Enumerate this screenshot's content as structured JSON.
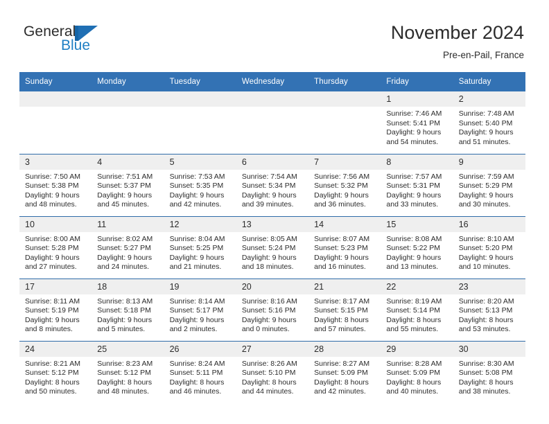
{
  "brand": {
    "name_part1": "General",
    "name_part2": "Blue"
  },
  "header": {
    "title": "November 2024",
    "subtitle": "Pre-en-Pail, France"
  },
  "calendar": {
    "weekday_headers": [
      "Sunday",
      "Monday",
      "Tuesday",
      "Wednesday",
      "Thursday",
      "Friday",
      "Saturday"
    ],
    "labels": {
      "sunrise": "Sunrise:",
      "sunset": "Sunset:",
      "daylight": "Daylight:"
    },
    "colors": {
      "header_blue": "#3372b4",
      "daynum_band": "#efefef",
      "row_separator": "#2e6ba8",
      "brand_blue": "#1f7fc4",
      "text": "#2b2b2b"
    },
    "weeks": [
      [
        {
          "day": "",
          "empty": true
        },
        {
          "day": "",
          "empty": true
        },
        {
          "day": "",
          "empty": true
        },
        {
          "day": "",
          "empty": true
        },
        {
          "day": "",
          "empty": true
        },
        {
          "day": "1",
          "sunrise": "Sunrise: 7:46 AM",
          "sunset": "Sunset: 5:41 PM",
          "daylight_line1": "Daylight: 9 hours",
          "daylight_line2": "and 54 minutes."
        },
        {
          "day": "2",
          "sunrise": "Sunrise: 7:48 AM",
          "sunset": "Sunset: 5:40 PM",
          "daylight_line1": "Daylight: 9 hours",
          "daylight_line2": "and 51 minutes."
        }
      ],
      [
        {
          "day": "3",
          "sunrise": "Sunrise: 7:50 AM",
          "sunset": "Sunset: 5:38 PM",
          "daylight_line1": "Daylight: 9 hours",
          "daylight_line2": "and 48 minutes."
        },
        {
          "day": "4",
          "sunrise": "Sunrise: 7:51 AM",
          "sunset": "Sunset: 5:37 PM",
          "daylight_line1": "Daylight: 9 hours",
          "daylight_line2": "and 45 minutes."
        },
        {
          "day": "5",
          "sunrise": "Sunrise: 7:53 AM",
          "sunset": "Sunset: 5:35 PM",
          "daylight_line1": "Daylight: 9 hours",
          "daylight_line2": "and 42 minutes."
        },
        {
          "day": "6",
          "sunrise": "Sunrise: 7:54 AM",
          "sunset": "Sunset: 5:34 PM",
          "daylight_line1": "Daylight: 9 hours",
          "daylight_line2": "and 39 minutes."
        },
        {
          "day": "7",
          "sunrise": "Sunrise: 7:56 AM",
          "sunset": "Sunset: 5:32 PM",
          "daylight_line1": "Daylight: 9 hours",
          "daylight_line2": "and 36 minutes."
        },
        {
          "day": "8",
          "sunrise": "Sunrise: 7:57 AM",
          "sunset": "Sunset: 5:31 PM",
          "daylight_line1": "Daylight: 9 hours",
          "daylight_line2": "and 33 minutes."
        },
        {
          "day": "9",
          "sunrise": "Sunrise: 7:59 AM",
          "sunset": "Sunset: 5:29 PM",
          "daylight_line1": "Daylight: 9 hours",
          "daylight_line2": "and 30 minutes."
        }
      ],
      [
        {
          "day": "10",
          "sunrise": "Sunrise: 8:00 AM",
          "sunset": "Sunset: 5:28 PM",
          "daylight_line1": "Daylight: 9 hours",
          "daylight_line2": "and 27 minutes."
        },
        {
          "day": "11",
          "sunrise": "Sunrise: 8:02 AM",
          "sunset": "Sunset: 5:27 PM",
          "daylight_line1": "Daylight: 9 hours",
          "daylight_line2": "and 24 minutes."
        },
        {
          "day": "12",
          "sunrise": "Sunrise: 8:04 AM",
          "sunset": "Sunset: 5:25 PM",
          "daylight_line1": "Daylight: 9 hours",
          "daylight_line2": "and 21 minutes."
        },
        {
          "day": "13",
          "sunrise": "Sunrise: 8:05 AM",
          "sunset": "Sunset: 5:24 PM",
          "daylight_line1": "Daylight: 9 hours",
          "daylight_line2": "and 18 minutes."
        },
        {
          "day": "14",
          "sunrise": "Sunrise: 8:07 AM",
          "sunset": "Sunset: 5:23 PM",
          "daylight_line1": "Daylight: 9 hours",
          "daylight_line2": "and 16 minutes."
        },
        {
          "day": "15",
          "sunrise": "Sunrise: 8:08 AM",
          "sunset": "Sunset: 5:22 PM",
          "daylight_line1": "Daylight: 9 hours",
          "daylight_line2": "and 13 minutes."
        },
        {
          "day": "16",
          "sunrise": "Sunrise: 8:10 AM",
          "sunset": "Sunset: 5:20 PM",
          "daylight_line1": "Daylight: 9 hours",
          "daylight_line2": "and 10 minutes."
        }
      ],
      [
        {
          "day": "17",
          "sunrise": "Sunrise: 8:11 AM",
          "sunset": "Sunset: 5:19 PM",
          "daylight_line1": "Daylight: 9 hours",
          "daylight_line2": "and 8 minutes."
        },
        {
          "day": "18",
          "sunrise": "Sunrise: 8:13 AM",
          "sunset": "Sunset: 5:18 PM",
          "daylight_line1": "Daylight: 9 hours",
          "daylight_line2": "and 5 minutes."
        },
        {
          "day": "19",
          "sunrise": "Sunrise: 8:14 AM",
          "sunset": "Sunset: 5:17 PM",
          "daylight_line1": "Daylight: 9 hours",
          "daylight_line2": "and 2 minutes."
        },
        {
          "day": "20",
          "sunrise": "Sunrise: 8:16 AM",
          "sunset": "Sunset: 5:16 PM",
          "daylight_line1": "Daylight: 9 hours",
          "daylight_line2": "and 0 minutes."
        },
        {
          "day": "21",
          "sunrise": "Sunrise: 8:17 AM",
          "sunset": "Sunset: 5:15 PM",
          "daylight_line1": "Daylight: 8 hours",
          "daylight_line2": "and 57 minutes."
        },
        {
          "day": "22",
          "sunrise": "Sunrise: 8:19 AM",
          "sunset": "Sunset: 5:14 PM",
          "daylight_line1": "Daylight: 8 hours",
          "daylight_line2": "and 55 minutes."
        },
        {
          "day": "23",
          "sunrise": "Sunrise: 8:20 AM",
          "sunset": "Sunset: 5:13 PM",
          "daylight_line1": "Daylight: 8 hours",
          "daylight_line2": "and 53 minutes."
        }
      ],
      [
        {
          "day": "24",
          "sunrise": "Sunrise: 8:21 AM",
          "sunset": "Sunset: 5:12 PM",
          "daylight_line1": "Daylight: 8 hours",
          "daylight_line2": "and 50 minutes."
        },
        {
          "day": "25",
          "sunrise": "Sunrise: 8:23 AM",
          "sunset": "Sunset: 5:12 PM",
          "daylight_line1": "Daylight: 8 hours",
          "daylight_line2": "and 48 minutes."
        },
        {
          "day": "26",
          "sunrise": "Sunrise: 8:24 AM",
          "sunset": "Sunset: 5:11 PM",
          "daylight_line1": "Daylight: 8 hours",
          "daylight_line2": "and 46 minutes."
        },
        {
          "day": "27",
          "sunrise": "Sunrise: 8:26 AM",
          "sunset": "Sunset: 5:10 PM",
          "daylight_line1": "Daylight: 8 hours",
          "daylight_line2": "and 44 minutes."
        },
        {
          "day": "28",
          "sunrise": "Sunrise: 8:27 AM",
          "sunset": "Sunset: 5:09 PM",
          "daylight_line1": "Daylight: 8 hours",
          "daylight_line2": "and 42 minutes."
        },
        {
          "day": "29",
          "sunrise": "Sunrise: 8:28 AM",
          "sunset": "Sunset: 5:09 PM",
          "daylight_line1": "Daylight: 8 hours",
          "daylight_line2": "and 40 minutes."
        },
        {
          "day": "30",
          "sunrise": "Sunrise: 8:30 AM",
          "sunset": "Sunset: 5:08 PM",
          "daylight_line1": "Daylight: 8 hours",
          "daylight_line2": "and 38 minutes."
        }
      ]
    ]
  }
}
